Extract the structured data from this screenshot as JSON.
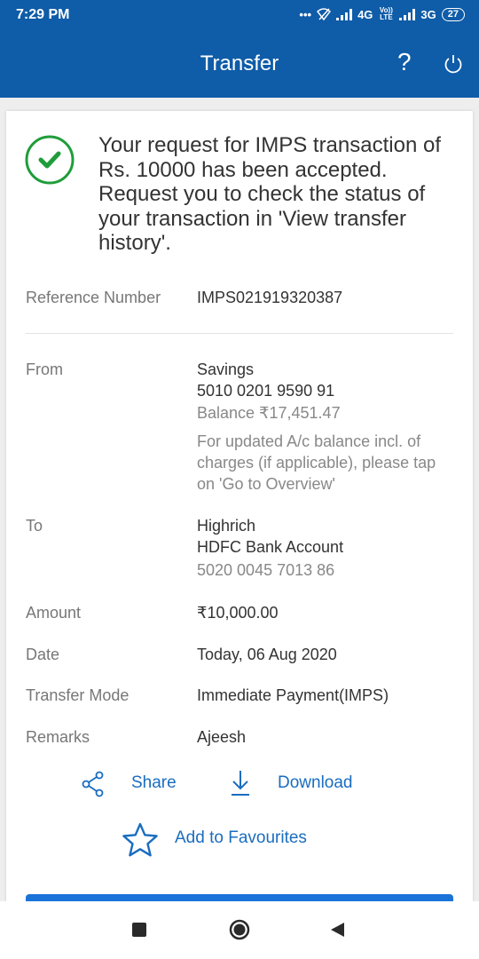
{
  "status_bar": {
    "time": "7:29 PM",
    "network_1": "4G",
    "network_2": "3G",
    "battery": "27",
    "volte": "Vo)) LTE"
  },
  "header": {
    "title": "Transfer",
    "help_symbol": "?"
  },
  "success": {
    "message": "Your request for IMPS transaction of Rs. 10000 has been accepted. Request you to check the status of your transaction in 'View transfer history'."
  },
  "details": {
    "reference": {
      "label": "Reference Number",
      "value": "IMPS021919320387"
    },
    "from": {
      "label": "From",
      "account_type": "Savings",
      "account_number": "5010 0201 9590 91",
      "balance": "Balance ₹17,451.47",
      "note": "For updated A/c balance incl. of charges (if applicable), please tap on 'Go to Overview'"
    },
    "to": {
      "label": "To",
      "name": "Highrich",
      "bank": "HDFC Bank Account",
      "account_number": "5020 0045 7013 86"
    },
    "amount": {
      "label": "Amount",
      "value": "₹10,000.00"
    },
    "date": {
      "label": "Date",
      "value": "Today, 06 Aug 2020"
    },
    "mode": {
      "label": "Transfer Mode",
      "value": "Immediate Payment(IMPS)"
    },
    "remarks": {
      "label": "Remarks",
      "value": "Ajeesh"
    }
  },
  "actions": {
    "share": "Share",
    "download": "Download",
    "favourites": "Add to Favourites"
  },
  "colors": {
    "primary": "#0f5ca8",
    "link": "#1a6dbf",
    "success": "#1f9d3a"
  },
  "icons": [
    "signal-icon",
    "wifi-off-icon",
    "battery-icon",
    "help-icon",
    "power-icon",
    "check-circle-icon",
    "share-icon",
    "download-icon",
    "star-icon",
    "recent-apps-icon",
    "home-icon",
    "back-icon"
  ]
}
